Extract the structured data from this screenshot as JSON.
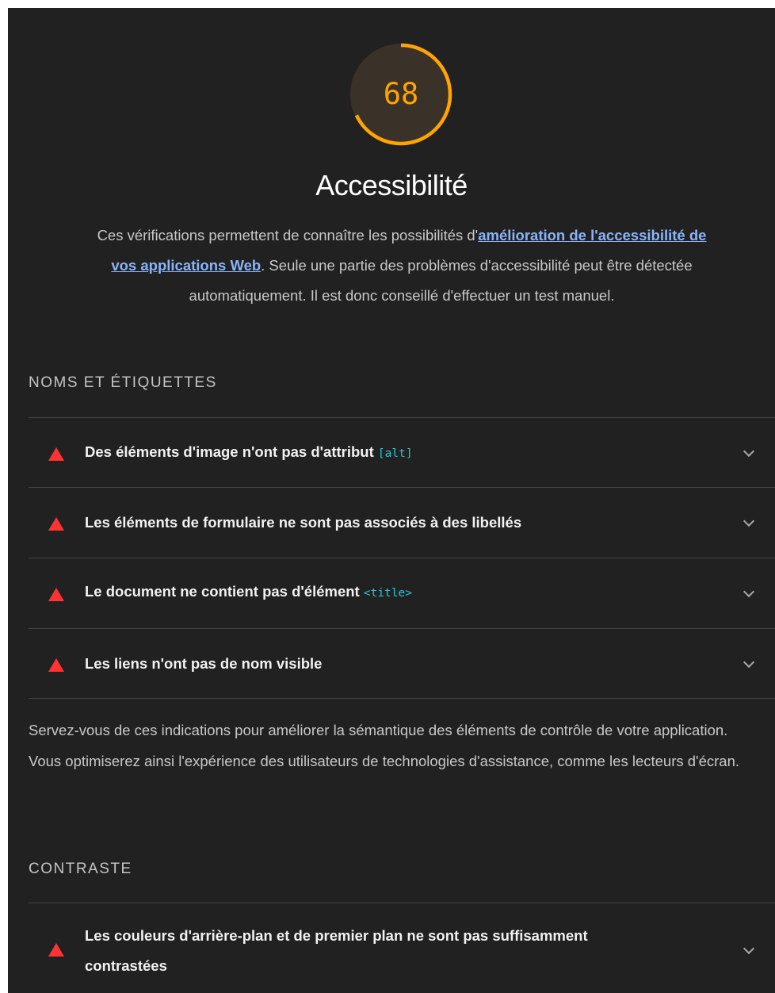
{
  "category": {
    "score": "68",
    "score_fraction": 0.68,
    "score_color": "#ffa400",
    "title": "Accessibilité",
    "description_before": "Ces vérifications permettent de connaître les possibilités d'",
    "description_link": "amélioration de l'accessibilité de vos applications Web",
    "description_after": ". Seule une partie des problèmes d'accessibilité peut être détectée automatiquement. Il est donc conseillé d'effectuer un test manuel."
  },
  "groups": [
    {
      "title": "NOMS ET ÉTIQUETTES",
      "audits": [
        {
          "title": "Des éléments d'image n'ont pas d'attribut",
          "code": "[alt]",
          "icon": "warning-triangle-icon"
        },
        {
          "title": "Les éléments de formulaire ne sont pas associés à des libellés",
          "code": "",
          "icon": "warning-triangle-icon"
        },
        {
          "title": "Le document ne contient pas d'élément",
          "code": "<title>",
          "icon": "warning-triangle-icon"
        },
        {
          "title": "Les liens n'ont pas de nom visible",
          "code": "",
          "icon": "warning-triangle-icon"
        }
      ],
      "description": "Servez-vous de ces indications pour améliorer la sémantique des éléments de contrôle de votre application. Vous optimiserez ainsi l'expérience des utilisateurs de technologies d'assistance, comme les lecteurs d'écran."
    },
    {
      "title": "CONTRASTE",
      "audits": [
        {
          "title": "Les couleurs d'arrière-plan et de premier plan ne sont pas suffisamment contrastées",
          "code": "",
          "icon": "warning-triangle-icon"
        }
      ]
    }
  ],
  "colors": {
    "background": "#212121",
    "fail": "#ff3333",
    "link": "#8ab4f8",
    "code": "#26c6da"
  }
}
